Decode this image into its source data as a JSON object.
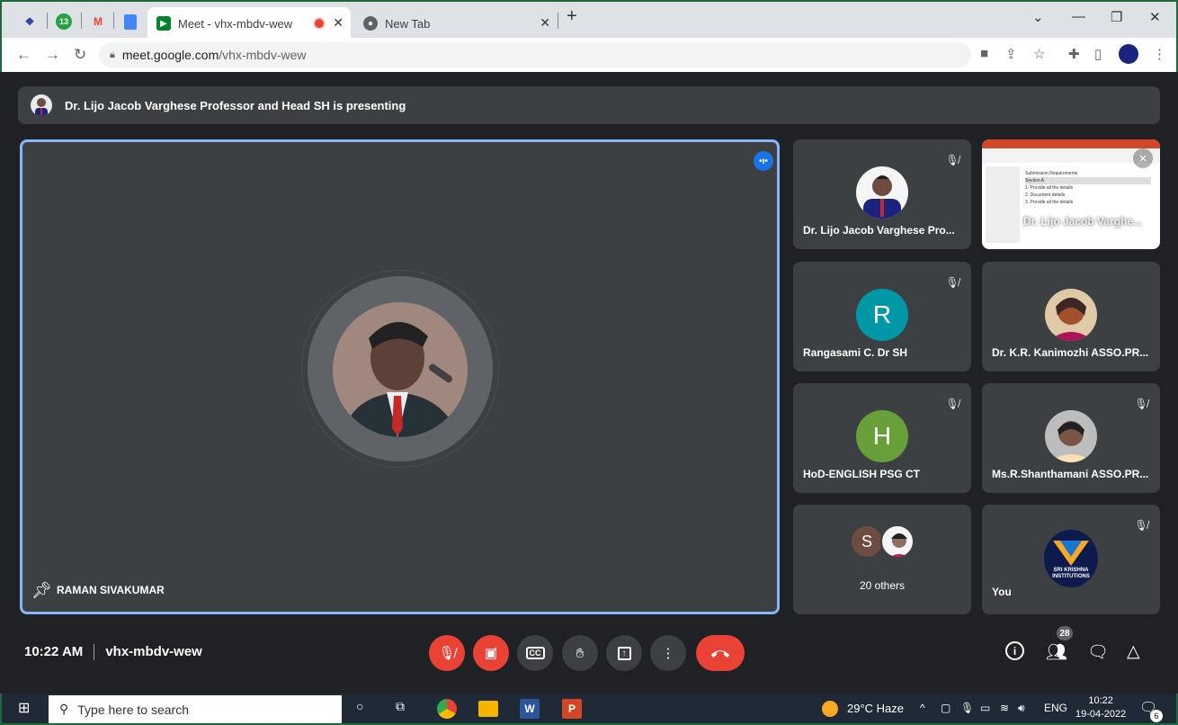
{
  "browser": {
    "tabs": [
      {
        "label": "Meet - vhx-mbdv-wew",
        "active": true
      },
      {
        "label": "New Tab",
        "active": false
      }
    ],
    "pinned_badge": "13",
    "url_host": "meet.google.com",
    "url_path": "/vhx-mbdv-wew"
  },
  "meet": {
    "presenting_banner": "Dr. Lijo Jacob Varghese Professor and Head SH is presenting",
    "main_speaker": "RAMAN SIVAKUMAR",
    "tiles": [
      {
        "name": "Dr. Lijo Jacob Varghese Pro...",
        "type": "photo",
        "muted": true
      },
      {
        "name": "Dr. Lijo Jacob Varghe...",
        "type": "screen",
        "muted": true
      },
      {
        "name": "Rangasami C. Dr SH",
        "type": "letter",
        "letter": "R",
        "color": "#0097a7",
        "muted": true
      },
      {
        "name": "Dr. K.R. Kanimozhi ASSO.PR...",
        "type": "photo",
        "muted": false
      },
      {
        "name": "HoD-ENGLISH PSG CT",
        "type": "letter",
        "letter": "H",
        "color": "#689f38",
        "muted": true
      },
      {
        "name": "Ms.R.Shanthamani ASSO.PR...",
        "type": "photo",
        "muted": true
      },
      {
        "name": "20 others",
        "type": "others",
        "letter": "S"
      },
      {
        "name": "You",
        "type": "logo",
        "logo_text": "SRI KRISHNA INSTITUTIONS",
        "muted": true
      }
    ],
    "time": "10:22 AM",
    "meeting_code": "vhx-mbdv-wew",
    "participant_count": "28",
    "slide_lines": [
      "Submission Requirements",
      "Section A",
      "1. Provide all the details",
      "2. Document details",
      "3. Provide all the details"
    ]
  },
  "taskbar": {
    "search_placeholder": "Type here to search",
    "weather": "29°C  Haze",
    "lang": "ENG",
    "time": "10:22",
    "date": "19-04-2022",
    "notif_count": "6"
  },
  "colors": {
    "accent": "#8ab4f8",
    "danger": "#ea4335",
    "tile": "#3c4043",
    "bg": "#202124"
  }
}
